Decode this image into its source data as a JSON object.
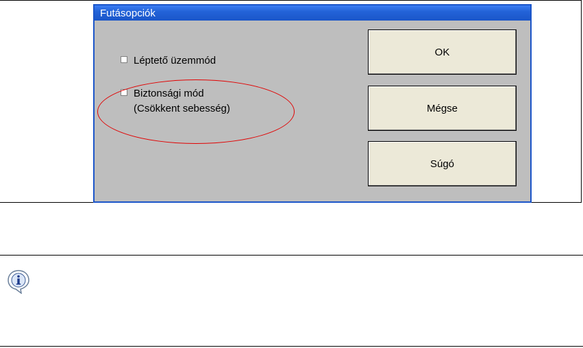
{
  "dialog": {
    "title": "Futásopciók",
    "options": [
      {
        "label_line1": "Léptető üzemmód",
        "label_line2": "",
        "checked": false
      },
      {
        "label_line1": "Biztonsági mód",
        "label_line2": "(Csökkent sebesség)",
        "checked": false
      }
    ],
    "buttons": {
      "ok": "OK",
      "cancel": "Mégse",
      "help": "Súgó"
    }
  },
  "colors": {
    "titlebar": "#2363d8",
    "dialog_bg": "#bebebe",
    "button_bg": "#ece9d8",
    "highlight": "#e20000"
  },
  "note": {
    "icon": "info-icon"
  }
}
